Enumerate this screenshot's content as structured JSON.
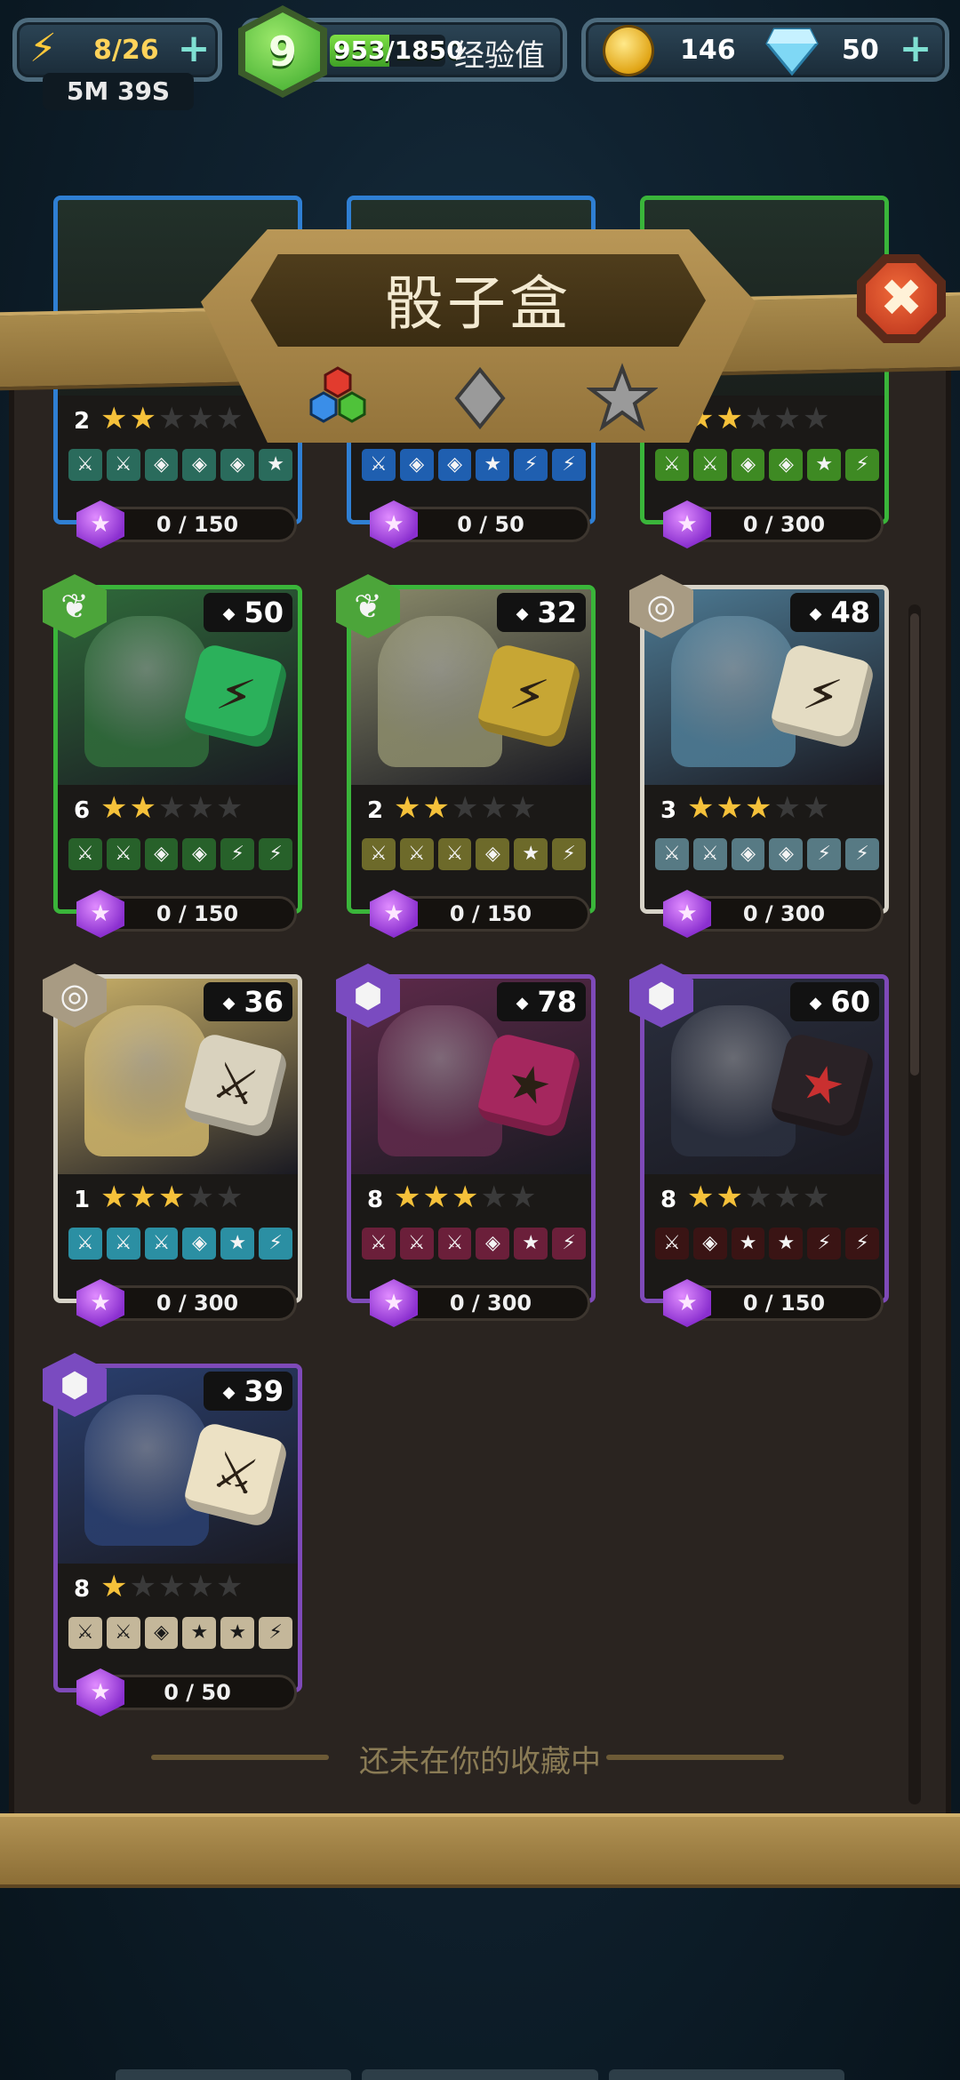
{
  "hud": {
    "energy": "8/26",
    "energy_timer": "5M 39S",
    "level": "9",
    "xp": "953/1850",
    "xp_progress": 0.515,
    "xp_label": "经验值",
    "coins": "146",
    "gems": "50"
  },
  "panel": {
    "title": "骰子盒",
    "tabs": [
      {
        "icon": "colored-dice-icon"
      },
      {
        "icon": "gray-diamond-icon"
      },
      {
        "icon": "star-icon"
      }
    ],
    "not_in_collection": "还未在你的收藏中"
  },
  "cards": [
    {
      "level": "2",
      "stars": 2,
      "progress": "0 / 150",
      "border": "#2f7fd3",
      "faces": [
        "⚔",
        "⚔",
        "◈",
        "◈",
        "◈",
        "★"
      ],
      "face_bg": "#2a6b5c",
      "partial": true
    },
    {
      "level": "",
      "stars": 0,
      "progress": "0 / 50",
      "border": "#2f7fd3",
      "faces": [
        "⚔",
        "◈",
        "◈",
        "★",
        "⚡",
        "⚡"
      ],
      "face_bg": "#1f5fb0",
      "partial": true
    },
    {
      "level": "",
      "stars": 2,
      "progress": "0 / 300",
      "border": "#3ab53a",
      "faces": [
        "⚔",
        "⚔",
        "◈",
        "◈",
        "★",
        "⚡"
      ],
      "face_bg": "#3e8a23",
      "partial": true
    },
    {
      "level": "6",
      "stars": 2,
      "progress": "0 / 150",
      "gems": "50",
      "border": "#3ab53a",
      "rarity": "leaf",
      "rarity_color": "#4ca53a",
      "faces": [
        "⚔",
        "⚔",
        "◈",
        "◈",
        "⚡",
        "⚡"
      ],
      "face_bg": "#27612a",
      "art": "#2f6a3a",
      "die_color": "#2bb15b",
      "die_glyph": "⚡"
    },
    {
      "level": "2",
      "stars": 2,
      "progress": "0 / 150",
      "gems": "32",
      "border": "#3ab53a",
      "rarity": "leaf",
      "rarity_color": "#4ca53a",
      "faces": [
        "⚔",
        "⚔",
        "⚔",
        "◈",
        "★",
        "⚡"
      ],
      "face_bg": "#6d6a2a",
      "art": "#8a8a6a",
      "die_color": "#c7a634",
      "die_glyph": "⚡"
    },
    {
      "level": "3",
      "stars": 3,
      "progress": "0 / 300",
      "gems": "48",
      "border": "#d7d3c8",
      "rarity": "swirl",
      "rarity_color": "#a89b83",
      "faces": [
        "⚔",
        "⚔",
        "◈",
        "◈",
        "⚡",
        "⚡"
      ],
      "face_bg": "#577a84",
      "art": "#4d7a93",
      "die_color": "#e4dcc3",
      "die_glyph": "⚡"
    },
    {
      "level": "1",
      "stars": 3,
      "progress": "0 / 300",
      "gems": "36",
      "border": "#d7d3c8",
      "rarity": "swirl",
      "rarity_color": "#a89b83",
      "faces": [
        "⚔",
        "⚔",
        "⚔",
        "◈",
        "★",
        "⚡"
      ],
      "face_bg": "#2b8fa3",
      "art": "#c9b068",
      "die_color": "#d9d2be",
      "die_glyph": "⚔"
    },
    {
      "level": "8",
      "stars": 3,
      "progress": "0 / 300",
      "gems": "78",
      "border": "#7e4ab8",
      "rarity": "hex",
      "rarity_color": "#7a4bc0",
      "faces": [
        "⚔",
        "⚔",
        "⚔",
        "◈",
        "★",
        "⚡"
      ],
      "face_bg": "#6b1f3a",
      "art": "#5e2a4a",
      "die_color": "#a5275e",
      "die_glyph": "★"
    },
    {
      "level": "8",
      "stars": 2,
      "progress": "0 / 150",
      "gems": "60",
      "border": "#7e4ab8",
      "rarity": "hex",
      "rarity_color": "#7a4bc0",
      "faces": [
        "⚔",
        "◈",
        "★",
        "★",
        "⚡",
        "⚡"
      ],
      "face_bg": "#3a1414",
      "art": "#2a2f3e",
      "die_color": "#2a2226",
      "die_glyph": "★"
    },
    {
      "level": "8",
      "stars": 1,
      "progress": "0 / 50",
      "gems": "39",
      "border": "#7e4ab8",
      "rarity": "hex",
      "rarity_color": "#7a4bc0",
      "faces": [
        "⚔",
        "⚔",
        "◈",
        "★",
        "★",
        "⚡"
      ],
      "face_bg": "#c4b79a",
      "art": "#2a3f6e",
      "die_color": "#ece1c4",
      "die_glyph": "⚔"
    }
  ],
  "colors": {
    "panel_bg": "#2a2420",
    "wood": "#a88a4c",
    "star_on": "#f5c13a",
    "shard": "#9b3fdf"
  }
}
